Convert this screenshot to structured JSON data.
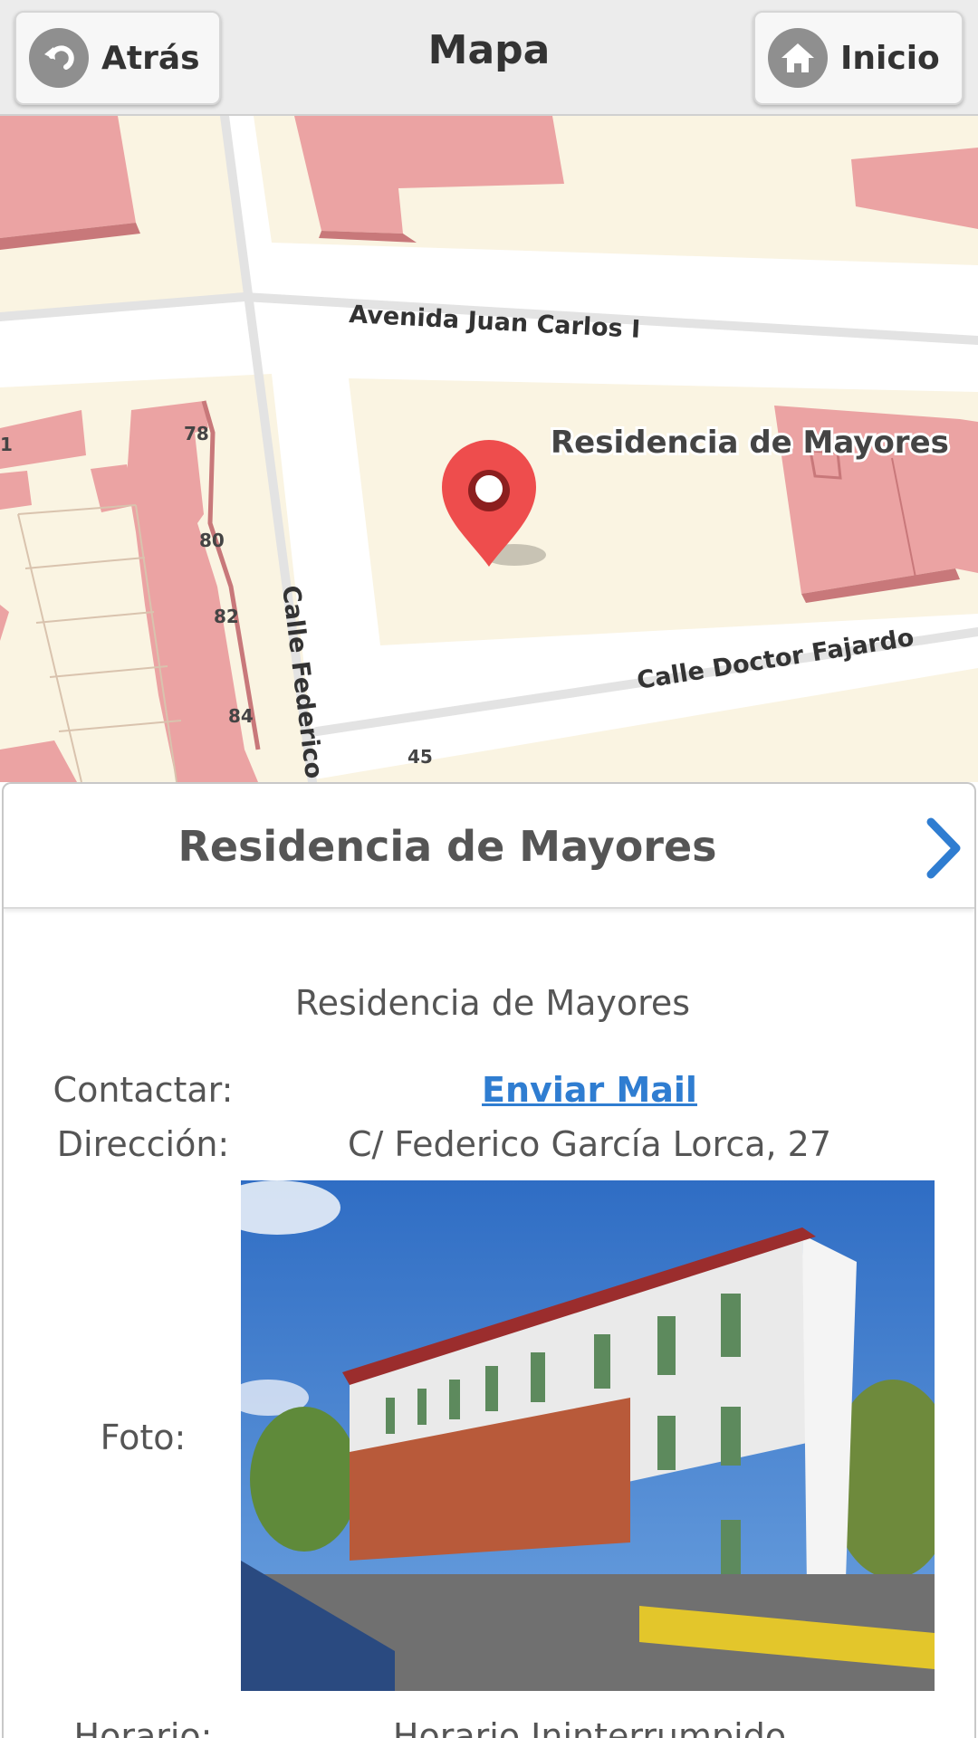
{
  "header": {
    "back_label": "Atrás",
    "title": "Mapa",
    "home_label": "Inicio",
    "back_icon": "back-arrow-icon",
    "home_icon": "home-icon"
  },
  "map": {
    "streets": [
      "Avenida Juan Carlos I",
      "Calle Federico G",
      "Calle Doctor Fajardo"
    ],
    "house_numbers": [
      "78",
      "80",
      "82",
      "84",
      "45",
      "1"
    ],
    "place_label": "Residencia de Mayores",
    "marker_icon": "map-pin-icon"
  },
  "detail": {
    "title": "Residencia de Mayores",
    "subtitle": "Residencia de Mayores",
    "contact_label": "Contactar:",
    "contact_value": "Enviar Mail",
    "address_label": "Dirección:",
    "address_value": "C/ Federico García Lorca, 27",
    "photo_label": "Foto:",
    "hours_label": "Horario:",
    "hours_value": "Horario Ininterrumpido"
  },
  "colors": {
    "accent": "#2f7dd1",
    "building": "#eba3a3",
    "land": "#faf4e2",
    "marker": "#ee4d4d"
  }
}
